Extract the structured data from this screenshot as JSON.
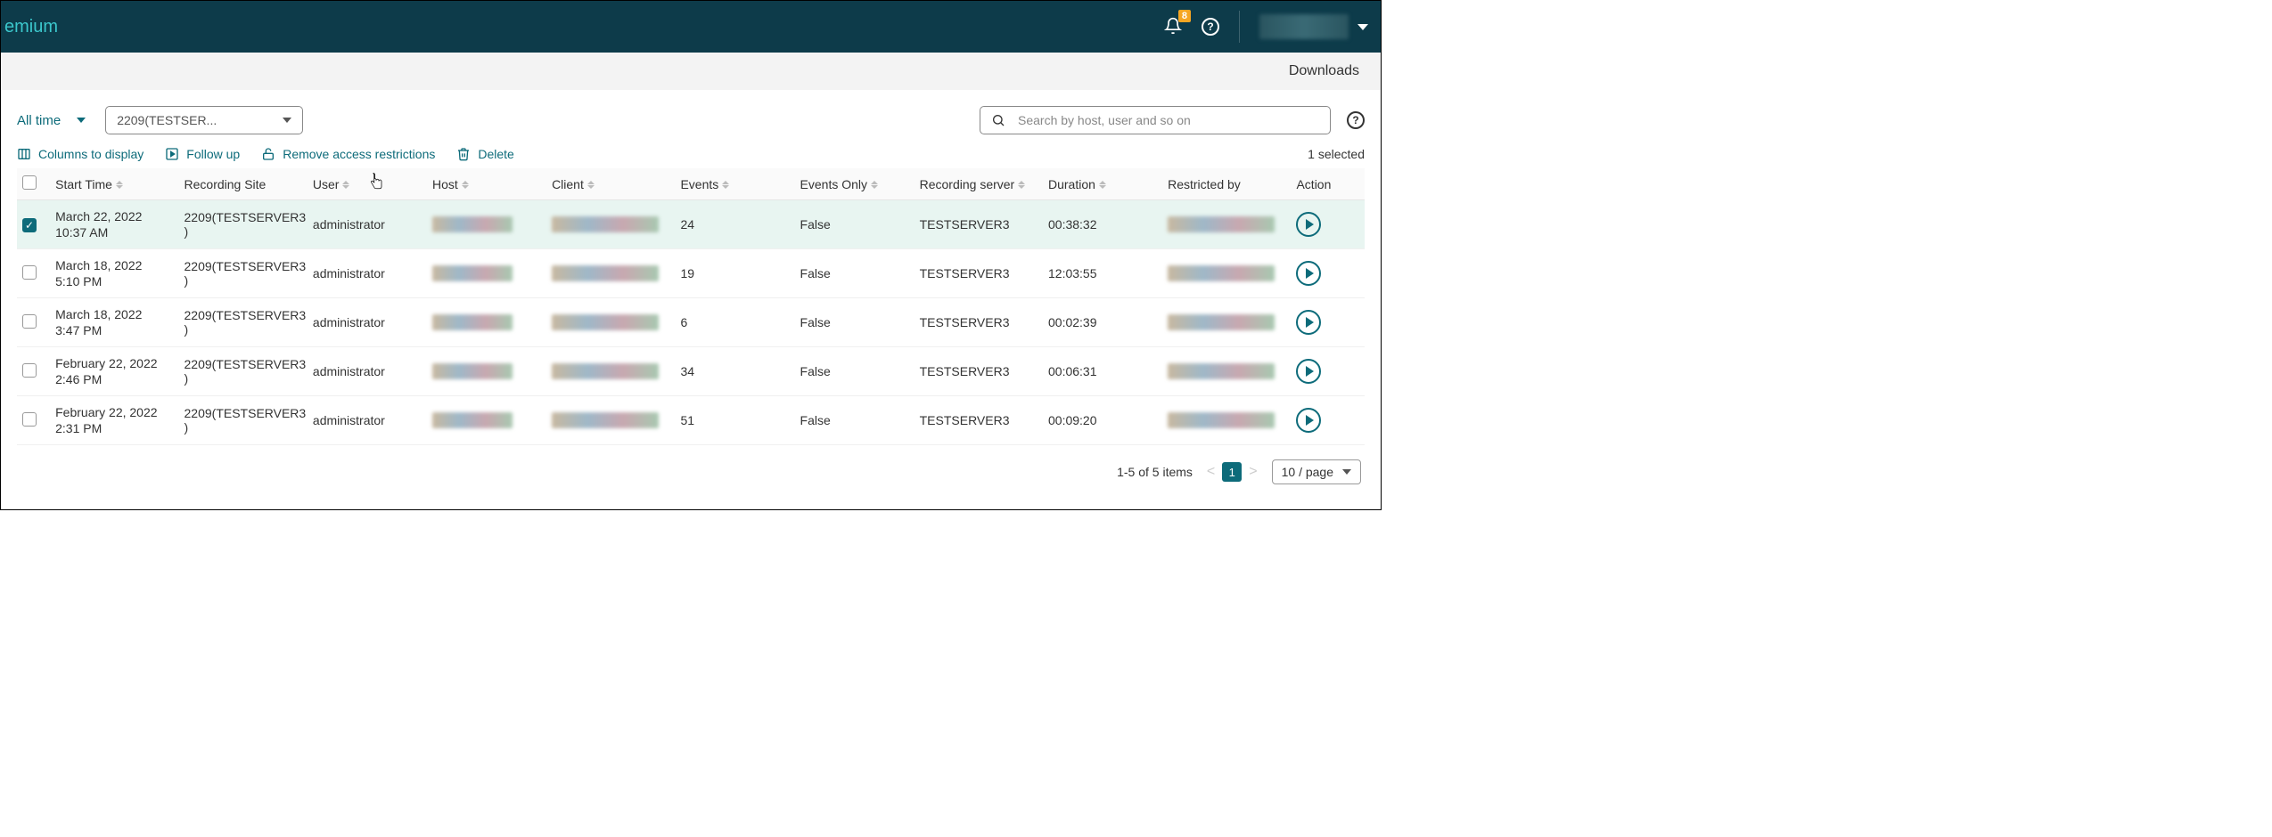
{
  "header": {
    "title_fragment": "emium",
    "notification_count": "8"
  },
  "subbar": {
    "downloads_label": "Downloads"
  },
  "filters": {
    "time_label": "All time",
    "site_selected": "2209(TESTSER..."
  },
  "search": {
    "placeholder": "Search by host, user and so on"
  },
  "toolbar": {
    "columns_label": "Columns to display",
    "followup_label": "Follow up",
    "remove_label": "Remove access restrictions",
    "delete_label": "Delete",
    "selected_text": "1 selected"
  },
  "columns": {
    "start_time": "Start Time",
    "recording_site": "Recording Site",
    "user": "User",
    "host": "Host",
    "client": "Client",
    "events": "Events",
    "events_only": "Events Only",
    "recording_server": "Recording server",
    "duration": "Duration",
    "restricted_by": "Restricted by",
    "action": "Action"
  },
  "rows": [
    {
      "checked": true,
      "date": "March 22, 2022",
      "time": "10:37 AM",
      "site": "2209(TESTSERVER3)",
      "user": "administrator",
      "events": "24",
      "events_only": "False",
      "server": "TESTSERVER3",
      "duration": "00:38:32"
    },
    {
      "checked": false,
      "date": "March 18, 2022",
      "time": "5:10 PM",
      "site": "2209(TESTSERVER3)",
      "user": "administrator",
      "events": "19",
      "events_only": "False",
      "server": "TESTSERVER3",
      "duration": "12:03:55"
    },
    {
      "checked": false,
      "date": "March 18, 2022",
      "time": "3:47 PM",
      "site": "2209(TESTSERVER3)",
      "user": "administrator",
      "events": "6",
      "events_only": "False",
      "server": "TESTSERVER3",
      "duration": "00:02:39"
    },
    {
      "checked": false,
      "date": "February 22, 2022",
      "time": "2:46 PM",
      "site": "2209(TESTSERVER3)",
      "user": "administrator",
      "events": "34",
      "events_only": "False",
      "server": "TESTSERVER3",
      "duration": "00:06:31"
    },
    {
      "checked": false,
      "date": "February 22, 2022",
      "time": "2:31 PM",
      "site": "2209(TESTSERVER3)",
      "user": "administrator",
      "events": "51",
      "events_only": "False",
      "server": "TESTSERVER3",
      "duration": "00:09:20"
    }
  ],
  "pagination": {
    "range_text": "1-5 of 5 items",
    "current_page": "1",
    "per_page": "10 / page"
  }
}
